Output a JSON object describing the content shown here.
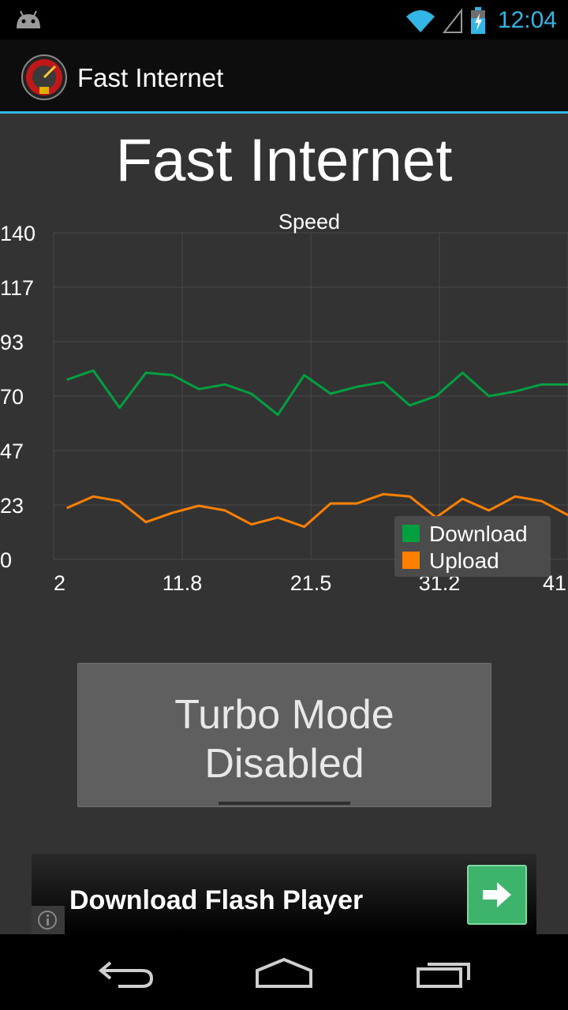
{
  "status_bar": {
    "time": "12:04",
    "icons": [
      "android-debug-icon",
      "wifi-icon",
      "signal-icon",
      "battery-charging-icon"
    ]
  },
  "action_bar": {
    "title": "Fast Internet",
    "icon": "speedometer-icon"
  },
  "header": {
    "title": "Fast Internet"
  },
  "chart_data": {
    "type": "line",
    "title": "Speed",
    "xlabel": "",
    "ylabel": "",
    "ylim": [
      0,
      140
    ],
    "xlim": [
      2,
      41
    ],
    "y_ticks": [
      "0",
      "23",
      "47",
      "70",
      "93",
      "117",
      "140"
    ],
    "x_ticks": [
      "2",
      "11.8",
      "21.5",
      "31.2",
      "41"
    ],
    "grid": true,
    "legend_position": "bottom-right",
    "x": [
      3,
      5,
      7,
      9,
      11,
      13,
      15,
      17,
      19,
      21,
      23,
      25,
      27,
      29,
      31,
      33,
      35,
      37,
      39,
      41
    ],
    "series": [
      {
        "name": "Download",
        "color": "#00a040",
        "values": [
          77,
          81,
          65,
          80,
          79,
          73,
          75,
          71,
          62,
          79,
          71,
          74,
          76,
          66,
          70,
          80,
          70,
          72,
          75,
          75
        ]
      },
      {
        "name": "Upload",
        "color": "#ff8000",
        "values": [
          22,
          27,
          25,
          16,
          20,
          23,
          21,
          15,
          18,
          14,
          24,
          24,
          28,
          27,
          18,
          26,
          21,
          27,
          25,
          19
        ]
      }
    ]
  },
  "turbo_button": {
    "line1": "Turbo Mode",
    "line2": "Disabled"
  },
  "ad": {
    "text": "Download Flash Player",
    "action_icon": "arrow-right-icon",
    "info_icon": "info-icon"
  },
  "nav_bar": {
    "icons": [
      "back-icon",
      "home-icon",
      "recent-apps-icon"
    ]
  }
}
